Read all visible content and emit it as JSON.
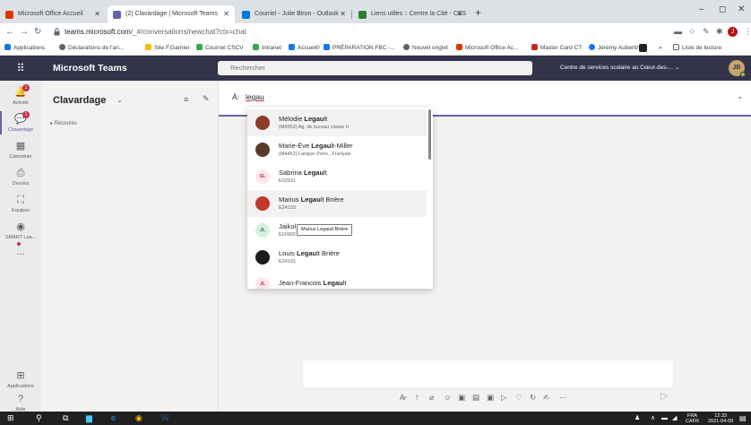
{
  "browser": {
    "tabs": [
      {
        "label": "Microsoft Office Accueil",
        "fav_color": "#d83b01"
      },
      {
        "label": "(2) Clavardage | Microsoft Teams",
        "fav_color": "#6264a7"
      },
      {
        "label": "Courriel - Julie Biron - Outlook",
        "fav_color": "#0078d4"
      },
      {
        "label": "Liens utiles :: Centre la Cité - CSS",
        "fav_color": "#2e7d32"
      }
    ],
    "new_tab": "+",
    "url_host": "teams.microsoft.com",
    "url_path": "/_#/conversations/newchat?ctx=chat",
    "bookmarks": [
      {
        "label": "Applications",
        "color": "#1a73e8"
      },
      {
        "label": "Déclarations de l'an...",
        "color": "#5f6368"
      },
      {
        "label": "Site F.Garnier",
        "color": "#fbbc04"
      },
      {
        "label": "Courriel CSCV",
        "color": "#34a853"
      },
      {
        "label": "Intranet",
        "color": "#34a853"
      },
      {
        "label": "Accueil0",
        "color": "#1877f2"
      },
      {
        "label": "PRÉPARATION FBC -...",
        "color": "#1a73e8"
      },
      {
        "label": "Nouvel onglet",
        "color": "#5f6368"
      },
      {
        "label": "Microsoft Office Ac...",
        "color": "#d83b01"
      },
      {
        "label": "Master Card CT",
        "color": "#c62828"
      },
      {
        "label": "Jérémy Aubertin",
        "color": "#1877f2"
      },
      {
        "label": "»",
        "color": "#ffffff"
      },
      {
        "label": "Liste de lecture",
        "color": "#5f6368"
      }
    ]
  },
  "teams": {
    "app_title": "Microsoft Teams",
    "search_placeholder": "Rechercher",
    "org_name": "Centre de services scolaire au Cœur-des-...",
    "me_initials": "JB",
    "rail": [
      {
        "label": "Activité",
        "icon": "bell-icon",
        "glyph": "🔔",
        "badge": "1"
      },
      {
        "label": "Clavardage",
        "icon": "chat-icon",
        "glyph": "💬",
        "badge": "1"
      },
      {
        "label": "Calendrier",
        "icon": "calendar-icon",
        "glyph": "▦",
        "badge": ""
      },
      {
        "label": "Devoirs",
        "icon": "assignments-icon",
        "glyph": "⎙",
        "badge": ""
      },
      {
        "label": "Équipes",
        "icon": "teams-icon",
        "glyph": "⛶",
        "badge": ""
      },
      {
        "label": "SMART Lea...",
        "icon": "smart-learning-icon",
        "glyph": "◉",
        "badge": ""
      },
      {
        "label": "...",
        "icon": "more-icon",
        "glyph": "",
        "badge": ""
      }
    ],
    "rail_bottom": [
      {
        "label": "Applications",
        "icon": "apps-icon",
        "glyph": "⊞"
      },
      {
        "label": "Aide",
        "icon": "help-icon",
        "glyph": "?"
      }
    ],
    "chat_title": "Clavardage",
    "recent_label": "Récentes",
    "to_label": "À:",
    "to_value": "legau",
    "tooltip": "Marius Legault Brière",
    "suggestions": [
      {
        "pre": "Mélodie ",
        "match": "Legau",
        "post": "lt",
        "sub": "(M4552) Ag. de bureau classe II",
        "initials": "",
        "av_color": "#8e3a2d",
        "highlight": true
      },
      {
        "pre": "Marie-Ève ",
        "match": "Legau",
        "post": "lt-Miller",
        "sub": "(M4452) Langue d'ens., Français",
        "initials": "",
        "av_color": "#5b3a2e",
        "highlight": false
      },
      {
        "pre": "Sabrina ",
        "match": "Legau",
        "post": "lt",
        "sub": "E02931",
        "initials": "SL",
        "av_color": "#fde7e9",
        "highlight": false
      },
      {
        "pre": "Marius ",
        "match": "Legau",
        "post": "lt Brière",
        "sub": "E24193",
        "initials": "",
        "av_color": "#c0392b",
        "highlight": true
      },
      {
        "pre": "Jaikol",
        "match": "",
        "post": "",
        "sub": "E00902",
        "initials": "JL",
        "av_color": "#d8efe1",
        "highlight": false
      },
      {
        "pre": "Louis ",
        "match": "Legau",
        "post": "lt Brière",
        "sub": "E24191",
        "initials": "",
        "av_color": "#1b1b1b",
        "highlight": false
      },
      {
        "pre": "Jean-Francois ",
        "match": "Legau",
        "post": "lt",
        "sub": "",
        "initials": "JL",
        "av_color": "#fde7e9",
        "highlight": false
      }
    ],
    "format_icons": [
      "format-icon",
      "important-icon",
      "attach-icon",
      "emoji-icon",
      "gif-icon",
      "sticker-icon",
      "meet-icon",
      "stream-icon",
      "praise-icon",
      "loop-icon",
      "sign-icon",
      "more-options-icon"
    ],
    "format_glyphs": [
      "A̷",
      "!",
      "⌀",
      "☺",
      "▣",
      "▤",
      "▣",
      "▷",
      "♡",
      "↻",
      "✍",
      "···"
    ]
  },
  "taskbar": {
    "lang": "FRA",
    "layout": "CAFR",
    "time": "12:33",
    "date": "2021-04-09"
  }
}
